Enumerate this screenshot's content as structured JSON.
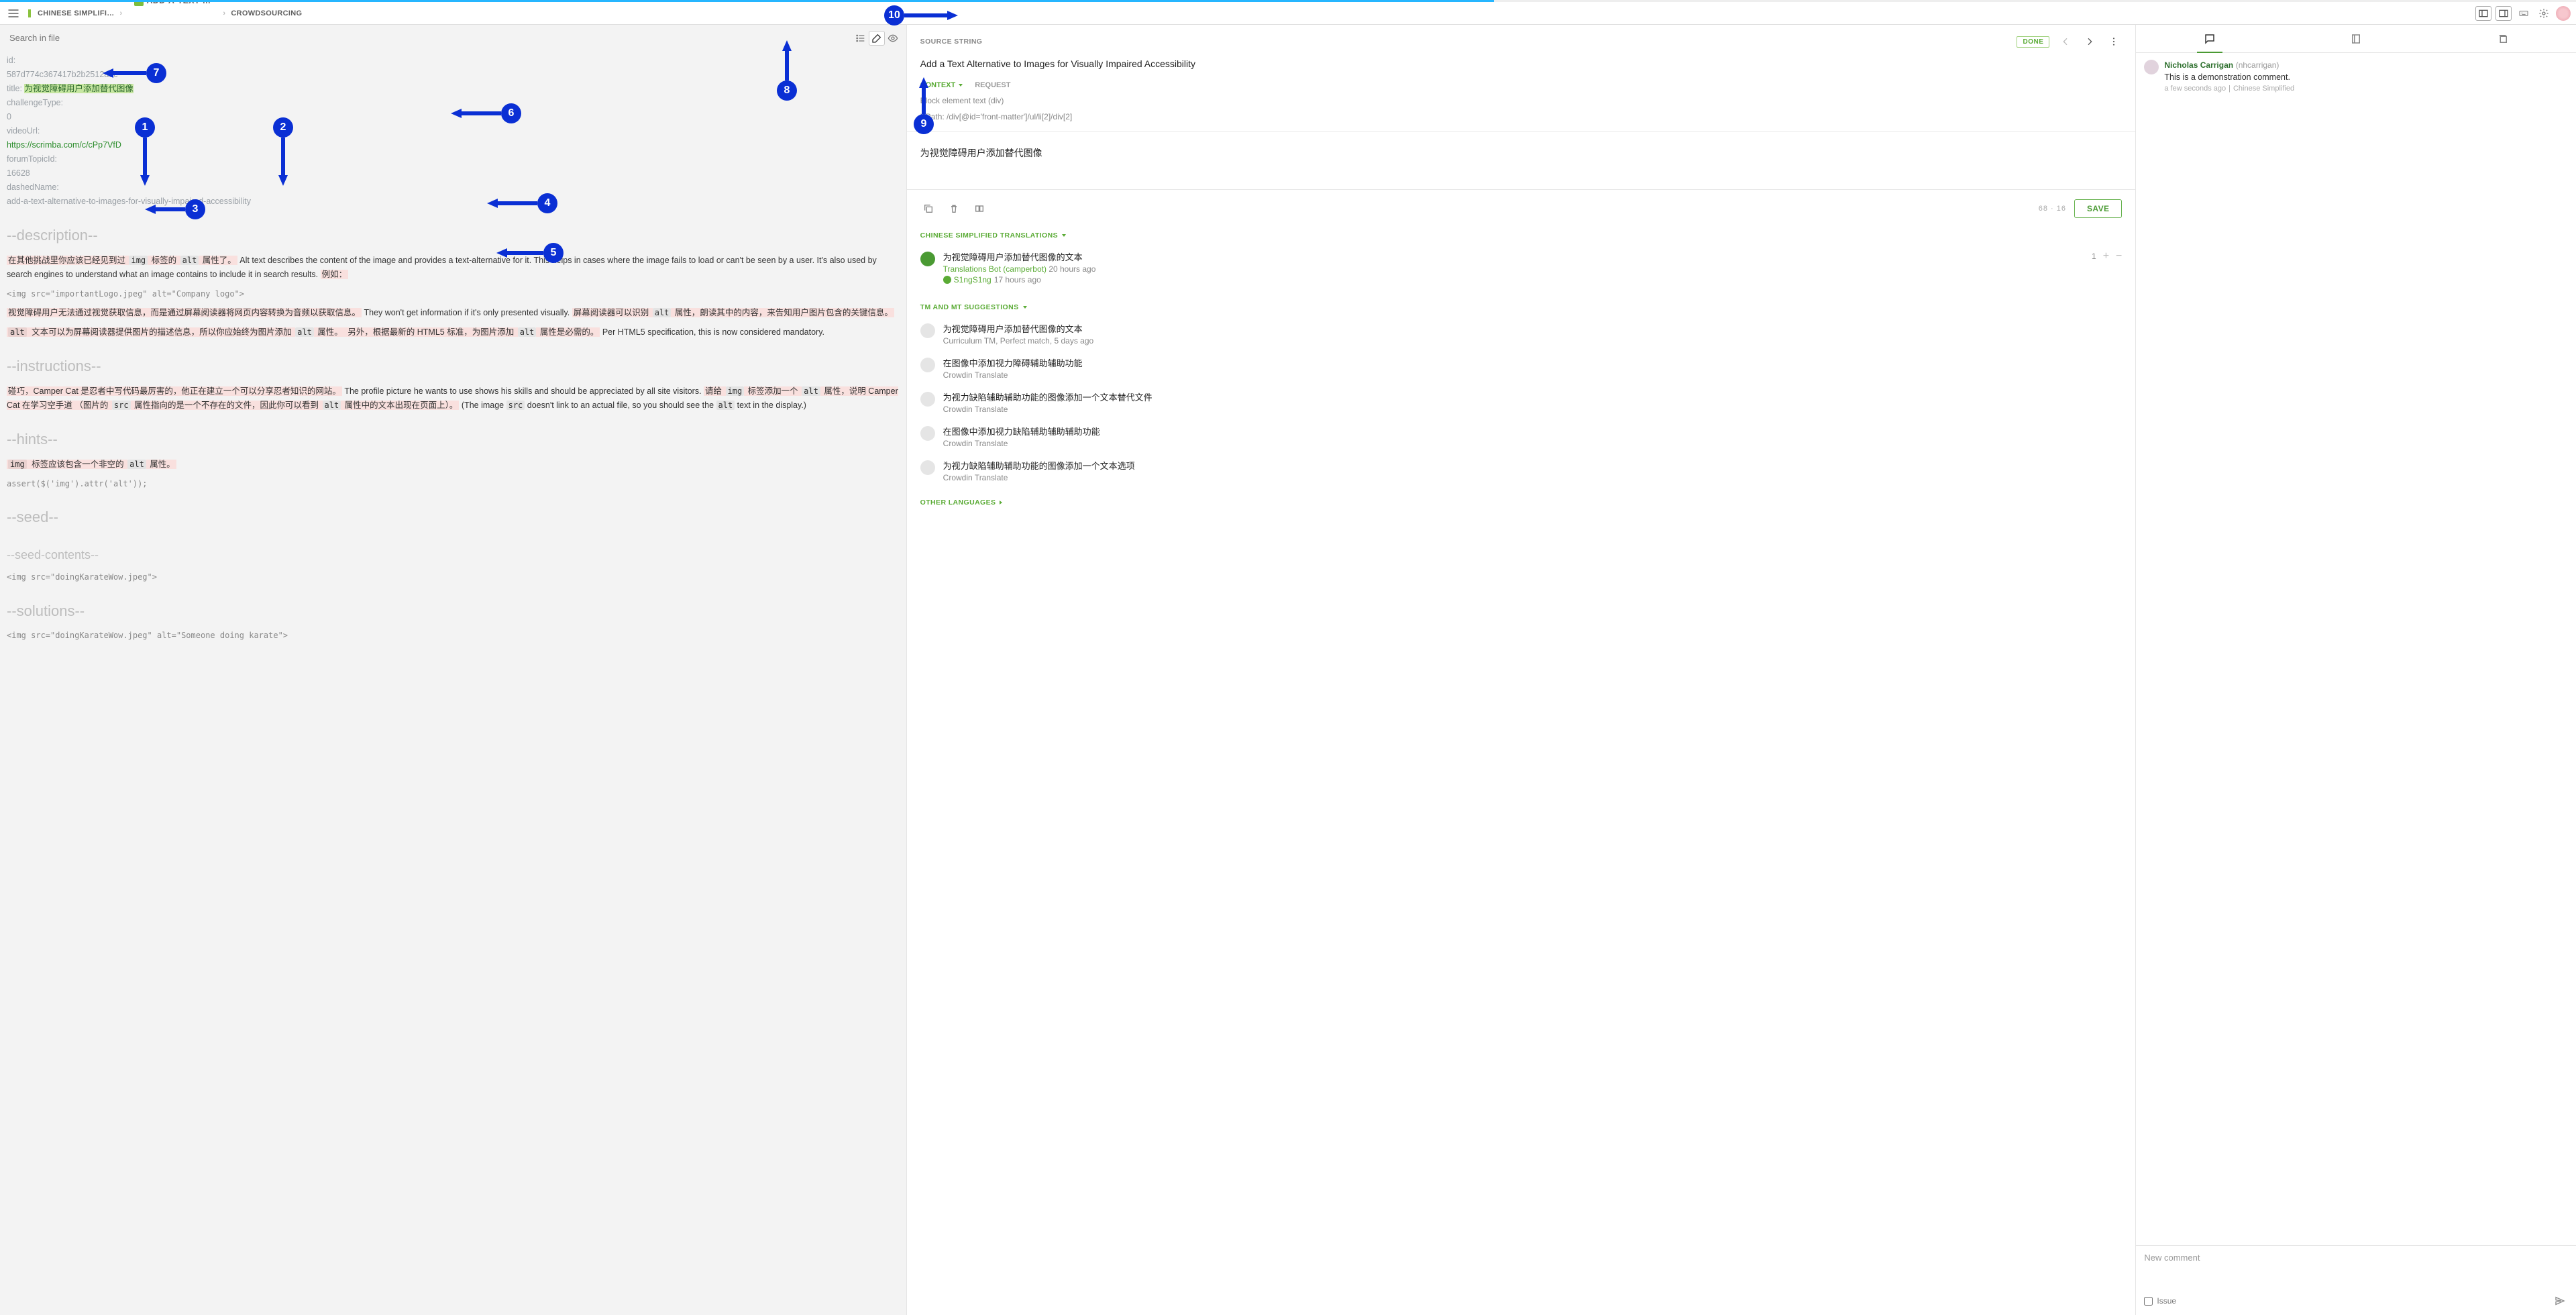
{
  "breadcrumb": {
    "lang": "CHINESE SIMPLIFI…",
    "file": "ADD-A-TEXT-…",
    "mode": "CROWDSOURCING"
  },
  "search_placeholder": "Search in file",
  "source": {
    "label": "SOURCE STRING",
    "status": "DONE",
    "title": "Add a Text Alternative to Images for Visually Impaired Accessibility",
    "context_label": "CONTEXT",
    "request_label": "REQUEST",
    "block": "Block element text (div)",
    "xpath": "XPath: /div[@id='front-matter']/ul/li[2]/div[2]"
  },
  "translation": {
    "text": "为视觉障碍用户添加替代图像",
    "counts": "68  ·  16",
    "save": "SAVE"
  },
  "translations_header": "CHINESE SIMPLIFIED TRANSLATIONS",
  "approved": {
    "text": "为视觉障碍用户添加替代图像的文本",
    "author": "Translations Bot (camperbot)",
    "author_ago": "20 hours ago",
    "approver": "S1ngS1ng",
    "approver_ago": "17 hours ago",
    "score": "1"
  },
  "tm_header": "TM AND MT SUGGESTIONS",
  "suggestions": [
    {
      "text": "为视觉障碍用户添加替代图像的文本",
      "sub": "Curriculum TM, Perfect match, 5 days ago"
    },
    {
      "text": "在图像中添加视力障碍辅助辅助功能",
      "sub": "Crowdin Translate"
    },
    {
      "text": "为视力缺陷辅助辅助功能的图像添加一个文本替代文件",
      "sub": "Crowdin Translate"
    },
    {
      "text": "在图像中添加视力缺陷辅助辅助辅助功能",
      "sub": "Crowdin Translate"
    },
    {
      "text": "为视力缺陷辅助辅助功能的图像添加一个文本选项",
      "sub": "Crowdin Translate"
    }
  ],
  "other_langs": "OTHER LANGUAGES",
  "file": {
    "id_k": "id:",
    "id_v": "587d774c367417b2b2512a9c",
    "title_k": "title:",
    "title_v": "为视觉障碍用户添加替代图像",
    "chtype_k": "challengeType:",
    "chtype_v": "0",
    "video_k": "videoUrl:",
    "video_v": "https://scrimba.com/c/cPp7VfD",
    "forum_k": "forumTopicId:",
    "forum_v": "16628",
    "dash_k": "dashedName:",
    "dash_v": "add-a-text-alternative-to-images-for-visually-impaired-accessibility",
    "s_desc": "--description--",
    "s_instr": "--instructions--",
    "s_hints": "--hints--",
    "s_seed": "--seed--",
    "s_seedc": "--seed-contents--",
    "s_sol": "--solutions--",
    "desc1a": "在其他挑战里你应该已经见到过 ",
    "desc1b": " 标签的 ",
    "desc1c": " 属性了。",
    "desc1d": " Alt text describes the content of the image and provides a text-alternative for it. This helps in cases where the image fails to load or can't be seen by a user. It's also used by search engines to understand what an image contains to include it in search results. ",
    "desc1e": "例如：",
    "codeimg": "<img src=\"importantLogo.jpeg\" alt=\"Company logo\">",
    "desc2a": "视觉障碍用户无法通过视觉获取信息，而是通过屏幕阅读器将网页内容转换为音频以获取信息。",
    "desc2b": " They won't get information if it's only presented visually. ",
    "desc2c": "屏幕阅读器可以识别 ",
    "desc2d": " 属性，朗读其中的内容，来告知用户图片包含的关键信息。",
    "desc3a": " 文本可以为屏幕阅读器提供图片的描述信息，所以你应始终为图片添加 ",
    "desc3b": " 属性。",
    "desc3c": " 另外，根据最新的 HTML5 标准，为图片添加 ",
    "desc3d": " 属性是必需的。",
    "desc3e": " Per HTML5 specification, this is now considered mandatory.",
    "instr1a": "碰巧，Camper Cat 是忍者中写代码最厉害的，他正在建立一个可以分享忍者知识的网站。",
    "instr1b": " The profile picture he wants to use shows his skills and should be appreciated by all site visitors. ",
    "instr1c": "请给 ",
    "instr1d": " 标签添加一个 ",
    "instr1e": " 属性，说明 Camper Cat 在学习空手道 （图片的 ",
    "instr1f": " 属性指向的是一个不存在的文件，因此你可以看到 ",
    "instr1g": " 属性中的文本出现在页面上）。",
    "instr1h": " (The image ",
    "instr1i": " doesn't link to an actual file, so you should see the ",
    "instr1j": " text in the display.)",
    "hint1a": " 标签应该包含一个非空的 ",
    "hint1b": " 属性。",
    "assert": "assert($('img').attr('alt'));",
    "seedcode": "<img src=\"doingKarateWow.jpeg\">",
    "solcode": "<img src=\"doingKarateWow.jpeg\" alt=\"Someone doing karate\">"
  },
  "comment": {
    "name": "Nicholas Carrigan",
    "handle": "(nhcarrigan)",
    "text": "This is a demonstration comment.",
    "ago": "a few seconds ago",
    "lang": "Chinese Simplified"
  },
  "new_comment_placeholder": "New comment",
  "issue_label": "Issue",
  "callouts": {
    "1": "1",
    "2": "2",
    "3": "3",
    "4": "4",
    "5": "5",
    "6": "6",
    "7": "7",
    "8": "8",
    "9": "9",
    "10": "10"
  }
}
